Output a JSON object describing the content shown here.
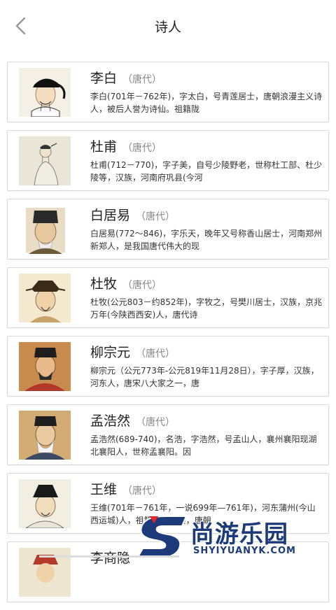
{
  "header": {
    "title": "诗人",
    "back_icon": "chevron-left-icon"
  },
  "poets": [
    {
      "name": "李白",
      "dynasty": "（唐代）",
      "desc": "李白(701年－762年)，字太白，号青莲居士，唐朝浪漫主义诗人，被后人誉为诗仙。祖籍陇"
    },
    {
      "name": "杜甫",
      "dynasty": "（唐代）",
      "desc": "杜甫(712－770)，字子美，自号少陵野老，世称杜工部、杜少陵等，汉族，河南府巩县(今河"
    },
    {
      "name": "白居易",
      "dynasty": "（唐代）",
      "desc": "白居易(772～846)，字乐天，晚年又号称香山居士，河南郑州新郑人，是我国唐代伟大的现"
    },
    {
      "name": "杜牧",
      "dynasty": "（唐代）",
      "desc": "杜牧(公元803－约852年)，字牧之，号樊川居士，汉族，京兆万年(今陕西西安)人，唐代诗"
    },
    {
      "name": "柳宗元",
      "dynasty": "（唐代）",
      "desc": "柳宗元（公元773年-公元819年11月28日），字子厚，汉族，河东人，唐宋八大家之一，唐"
    },
    {
      "name": "孟浩然",
      "dynasty": "（唐代）",
      "desc": "孟浩然(689-740)，名浩，字浩然，号孟山人，襄州襄阳现湖北襄阳人，世称孟襄阳。因"
    },
    {
      "name": "王维",
      "dynasty": "（唐代）",
      "desc": "王维(701年－761年，一说699年—761年)，河东蒲州(今山西运城)人，祖籍山西祁县，唐朝"
    },
    {
      "name": "李商隐",
      "dynasty": "",
      "desc": ""
    }
  ],
  "watermark": {
    "text": "尚游乐园",
    "url": "SHYIYUANYK.COM"
  },
  "colors": {
    "watermark": "#1d3a7a",
    "watermark_accent": "#e8252a",
    "border": "#d9d9d9"
  }
}
